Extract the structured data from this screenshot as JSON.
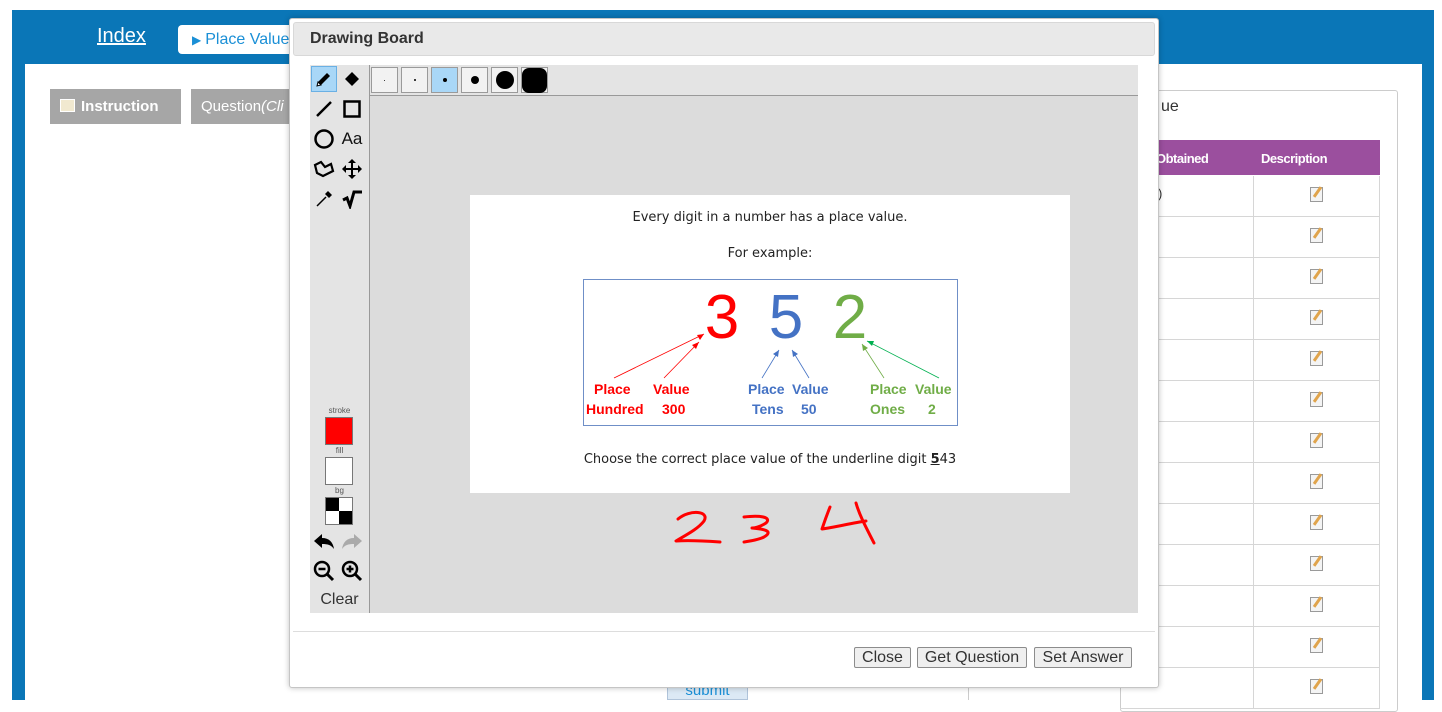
{
  "page": {
    "index_link": "Index",
    "tab_label": "Place Value",
    "instruction_label": "Instruction",
    "question_label": "Question",
    "question_suffix": "(Cli",
    "submit_label": "submit"
  },
  "results_panel": {
    "title": "ue",
    "columns": [
      "Obtained",
      "Description"
    ],
    "first_obtained": ")",
    "row_count": 13
  },
  "dialog": {
    "title": "Drawing Board",
    "tools": [
      "pencil-icon",
      "eraser-icon",
      "line-icon",
      "rectangle-icon",
      "circle-icon",
      "text-icon",
      "polygon-icon",
      "move-icon",
      "eyedropper-icon",
      "sqrt-icon"
    ],
    "text_tool_label": "Aa",
    "swatch_labels": {
      "stroke": "stroke",
      "fill": "fill",
      "bg": "bg"
    },
    "stroke_color": "#ff0000",
    "fill_color": "#ffffff",
    "clear_label": "Clear",
    "brush_sizes_active_index": 2,
    "buttons": {
      "close": "Close",
      "get_question": "Get Question",
      "set_answer": "Set Answer"
    }
  },
  "question": {
    "line1": "Every digit in a number has a place value.",
    "line2": "For example:",
    "digits": [
      {
        "digit": "3",
        "color": "#ff0000",
        "place_label": "Place",
        "place_name": "Hundred",
        "value_label": "Value",
        "value": "300"
      },
      {
        "digit": "5",
        "color": "#4472c4",
        "place_label": "Place",
        "place_name": "Tens",
        "value_label": "Value",
        "value": "50"
      },
      {
        "digit": "2",
        "color": "#70ad47",
        "place_label": "Place",
        "place_name": "Ones",
        "value_label": "Value",
        "value": "2"
      }
    ],
    "prompt_prefix": "Choose the correct place value of the underline digit ",
    "underlined_digit": "5",
    "prompt_suffix": "43"
  },
  "handwriting": {
    "text": "234",
    "color": "#ff0000"
  }
}
